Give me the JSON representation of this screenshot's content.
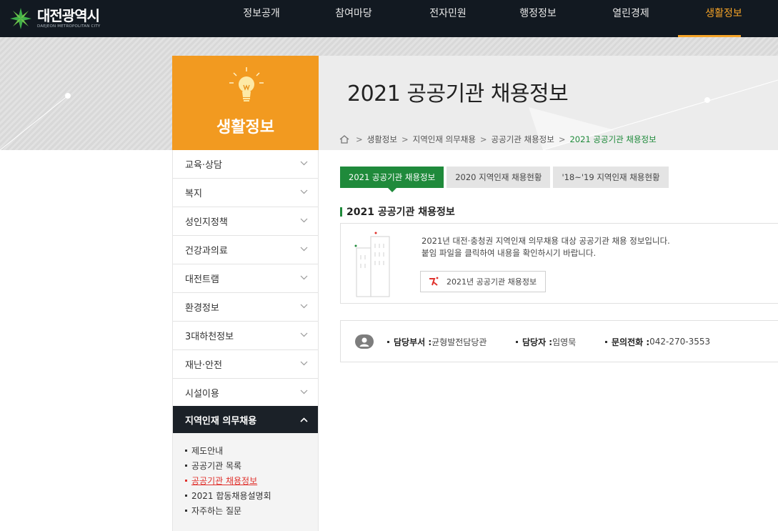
{
  "header": {
    "logo_title": "대전광역시",
    "logo_sub": "DAEJEON METROPOLITAN CITY",
    "nav": [
      {
        "label": "정보공개"
      },
      {
        "label": "참여마당"
      },
      {
        "label": "전자민원"
      },
      {
        "label": "행정정보"
      },
      {
        "label": "열린경제"
      },
      {
        "label": "생활정보"
      }
    ],
    "active_nav": "생활정보"
  },
  "page": {
    "title": "2021 공공기관 채용정보",
    "breadcrumb": [
      "생활정보",
      "지역인재 의무채용",
      "공공기관 채용정보",
      "2021 공공기관 채용정보"
    ],
    "home_icon": "home-icon"
  },
  "sidebar": {
    "title": "생활정보",
    "icon": "lightbulb-icon",
    "items": [
      {
        "label": "교육·상담"
      },
      {
        "label": "복지"
      },
      {
        "label": "성인지정책"
      },
      {
        "label": "건강과의료"
      },
      {
        "label": "대전트램"
      },
      {
        "label": "환경정보"
      },
      {
        "label": "3대하천정보"
      },
      {
        "label": "재난·안전"
      },
      {
        "label": "시설이용"
      },
      {
        "label": "지역인재 의무채용"
      }
    ],
    "sub_items": [
      {
        "label": "제도안내"
      },
      {
        "label": "공공기관 목록"
      },
      {
        "label": "공공기관 채용정보"
      },
      {
        "label": "2021 합동채용설명회"
      },
      {
        "label": "자주하는 질문"
      }
    ]
  },
  "tabs": [
    {
      "label": "2021 공공기관 채용정보"
    },
    {
      "label": "2020 지역인재 채용현황"
    },
    {
      "label": "'18~'19 지역인재 채용현황"
    }
  ],
  "content": {
    "section_title": "2021 공공기관 채용정보",
    "desc_line1": "2021년 대전·충청권 지역인재 의무채용 대상 공공기관 채용 정보입니다.",
    "desc_line2": "붙임 파일을 클릭하여 내용을 확인하시기 바랍니다.",
    "file_label": "2021년 공공기관 채용정보"
  },
  "contact": {
    "dept_label": "담당부서 :",
    "dept_value": " 균형발전담당관",
    "person_label": "담당자 :",
    "person_value": " 임영묵",
    "phone_label": "문의전화 :",
    "phone_value": " 042-270-3553"
  },
  "colors": {
    "accent_orange": "#f29a20",
    "accent_green": "#1f8a3b",
    "nav_bg": "#121921",
    "current_red": "#e0322d"
  }
}
